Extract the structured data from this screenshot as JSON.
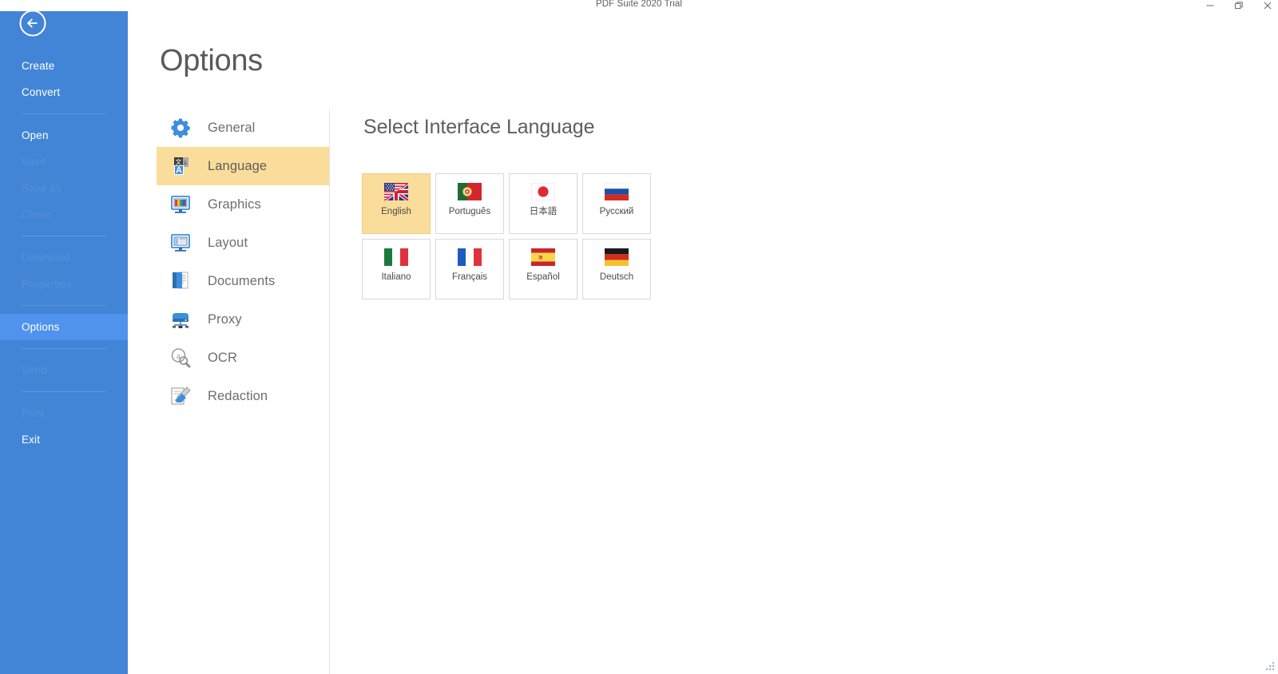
{
  "window": {
    "title": "PDF Suite 2020  Trial",
    "controls": [
      {
        "name": "minimize",
        "label": "—"
      },
      {
        "name": "restore",
        "label": "❐"
      },
      {
        "name": "close",
        "label": "✕"
      }
    ]
  },
  "sidebar": {
    "back_label": "Back",
    "items": [
      {
        "label": "Create",
        "state": "enabled"
      },
      {
        "label": "Convert",
        "state": "enabled"
      },
      {
        "label": "__SEP__",
        "state": "sep"
      },
      {
        "label": "Open",
        "state": "enabled"
      },
      {
        "label": "Save",
        "state": "disabled"
      },
      {
        "label": "Save as",
        "state": "disabled"
      },
      {
        "label": "Close",
        "state": "disabled"
      },
      {
        "label": "__SEP__",
        "state": "sep"
      },
      {
        "label": "Download",
        "state": "disabled"
      },
      {
        "label": "Properties",
        "state": "disabled"
      },
      {
        "label": "__SEP__",
        "state": "sep"
      },
      {
        "label": "Options",
        "state": "active"
      },
      {
        "label": "__SEP__",
        "state": "sep"
      },
      {
        "label": "Send",
        "state": "disabled"
      },
      {
        "label": "__SEP__",
        "state": "sep"
      },
      {
        "label": "Print",
        "state": "disabled"
      },
      {
        "label": "Exit",
        "state": "enabled"
      }
    ]
  },
  "page": {
    "title": "Options"
  },
  "options_nav": {
    "items": [
      {
        "label": "General",
        "icon": "gear-icon",
        "selected": false
      },
      {
        "label": "Language",
        "icon": "language-icon",
        "selected": true
      },
      {
        "label": "Graphics",
        "icon": "graphics-icon",
        "selected": false
      },
      {
        "label": "Layout",
        "icon": "layout-icon",
        "selected": false
      },
      {
        "label": "Documents",
        "icon": "documents-icon",
        "selected": false
      },
      {
        "label": "Proxy",
        "icon": "proxy-icon",
        "selected": false
      },
      {
        "label": "OCR",
        "icon": "ocr-icon",
        "selected": false
      },
      {
        "label": "Redaction",
        "icon": "redaction-icon",
        "selected": false
      }
    ]
  },
  "language_panel": {
    "heading": "Select Interface Language",
    "tiles": [
      {
        "label": "English",
        "flag": "flag-us-uk",
        "selected": true
      },
      {
        "label": "Português",
        "flag": "flag-pt",
        "selected": false
      },
      {
        "label": "日本語",
        "flag": "flag-jp",
        "selected": false
      },
      {
        "label": "Русский",
        "flag": "flag-ru",
        "selected": false
      },
      {
        "label": "Italiano",
        "flag": "flag-it",
        "selected": false
      },
      {
        "label": "Français",
        "flag": "flag-fr",
        "selected": false
      },
      {
        "label": "Español",
        "flag": "flag-es",
        "selected": false
      },
      {
        "label": "Deutsch",
        "flag": "flag-de",
        "selected": false
      }
    ]
  },
  "colors": {
    "sidebar_blue": "#4285d6",
    "sidebar_active_blue": "#4f93ee",
    "sidebar_disabled_text": "#5490da",
    "accent_amber": "#fbdd9b",
    "icon_blue": "#3e8ede",
    "text_gray": "#6e6e6e"
  }
}
